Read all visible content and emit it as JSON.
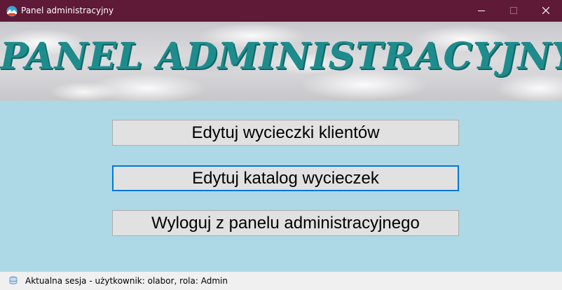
{
  "window": {
    "title": "Panel administracyjny",
    "colors": {
      "titlebar": "#5e1a36",
      "background": "#add8e6"
    }
  },
  "banner": {
    "title": "PANEL ADMINISTRACYJNY",
    "title_color": "#1e8c8c"
  },
  "menu": {
    "edit_trips": "Edytuj wycieczki klientów",
    "edit_catalog": "Edytuj katalog wycieczek",
    "logout": "Wyloguj z panelu administracyjnego",
    "focused": "edit_catalog"
  },
  "status": {
    "session_text": "Aktualna sesja - użytkownik: olabor, rola: Admin"
  },
  "icons": [
    "app-icon",
    "minimize-icon",
    "maximize-icon",
    "close-icon",
    "session-icon"
  ]
}
